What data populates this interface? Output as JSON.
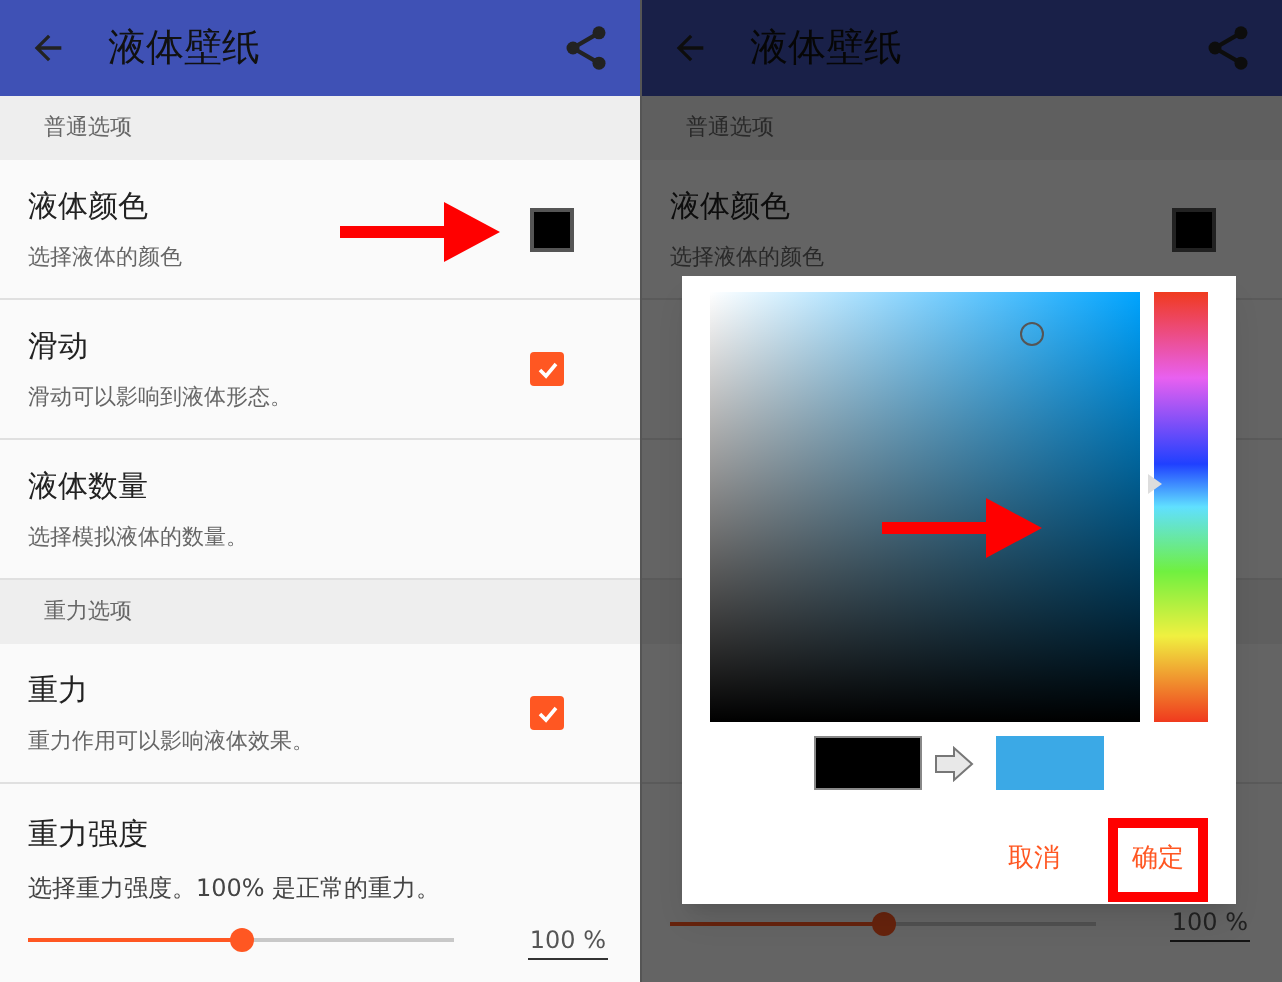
{
  "screens": [
    {
      "app_bar": {
        "title": "液体壁纸"
      },
      "items": [
        {
          "kind": "header",
          "title": "普通选项"
        },
        {
          "kind": "color",
          "title": "液体颜色",
          "subtitle": "选择液体的颜色",
          "color": "#000000"
        },
        {
          "kind": "checkbox",
          "title": "滑动",
          "subtitle": "滑动可以影响到液体形态。",
          "checked": true
        },
        {
          "kind": "plain",
          "title": "液体数量",
          "subtitle": "选择模拟液体的数量。"
        },
        {
          "kind": "header",
          "title": "重力选项"
        },
        {
          "kind": "checkbox",
          "title": "重力",
          "subtitle": "重力作用可以影响液体效果。",
          "checked": true
        },
        {
          "kind": "slider",
          "title": "重力强度",
          "subtitle": "选择重力强度。100% 是正常的重力。",
          "level": 0.5,
          "reading": "100 %"
        }
      ],
      "annotations": [
        {
          "kind": "arrow"
        }
      ]
    },
    {
      "app_bar": {
        "title": "液体壁纸"
      },
      "items": [
        {
          "kind": "header",
          "title": "普通选项"
        },
        {
          "kind": "color",
          "title": "液体颜色",
          "subtitle": "选择液体的颜色",
          "color": "#000000"
        },
        {
          "kind": "plain"
        },
        {
          "kind": "plain"
        },
        {
          "kind": "header"
        },
        {
          "kind": "plain"
        },
        {
          "kind": "slider",
          "level": 0.5,
          "reading": "100 %"
        }
      ],
      "dialog": {
        "swatches": [
          {
            "color": "#000000"
          },
          {
            "color": "#3ba9e6"
          }
        ],
        "buttons": [
          {
            "label": "取消",
            "highlighted": false
          },
          {
            "label": "确定",
            "highlighted": true
          }
        ]
      },
      "annotations": [
        {
          "kind": "arrow"
        }
      ]
    }
  ]
}
